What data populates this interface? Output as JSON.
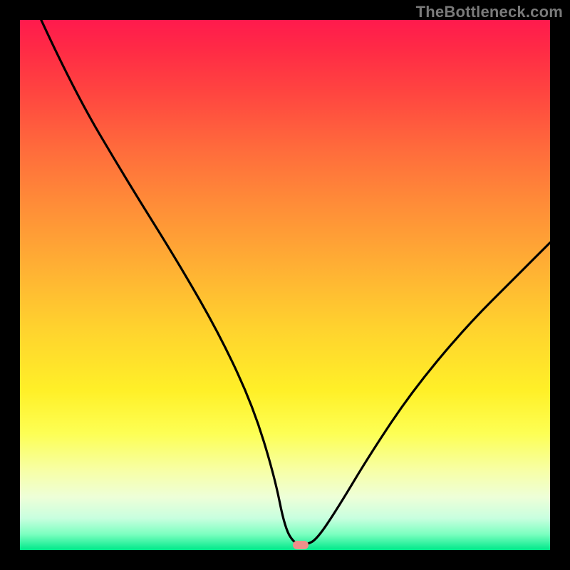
{
  "watermark": "TheBottleneck.com",
  "colors": {
    "frame_bg": "#000000",
    "curve": "#000000",
    "marker": "#ef8f8a",
    "gradient_top": "#ff1a4d",
    "gradient_bottom": "#00e98a"
  },
  "chart_data": {
    "type": "line",
    "title": "",
    "xlabel": "",
    "ylabel": "",
    "categories": [],
    "xlim_pct": [
      0,
      100
    ],
    "ylim_pct": [
      0,
      100
    ],
    "description": "V-shaped bottleneck curve on a vertical heat gradient (red = bad at top, green = good at bottom). Curve descends steeply from upper-left, reaches a minimum near x≈52%, briefly runs flat along the bottom, then rises to the right edge at roughly mid-height. A small rounded salmon marker sits at the minimum on the bottom edge.",
    "series": [
      {
        "name": "bottleneck-curve",
        "x_pct": [
          4,
          10,
          20,
          30,
          38,
          44,
          48,
          50,
          52,
          54,
          56,
          60,
          66,
          74,
          84,
          94,
          100
        ],
        "y_pct": [
          100,
          87,
          70,
          54,
          40,
          27,
          14,
          4,
          1,
          1,
          2,
          8,
          18,
          30,
          42,
          52,
          58
        ]
      }
    ],
    "marker": {
      "x_pct": 53,
      "y_pct": 1
    }
  }
}
